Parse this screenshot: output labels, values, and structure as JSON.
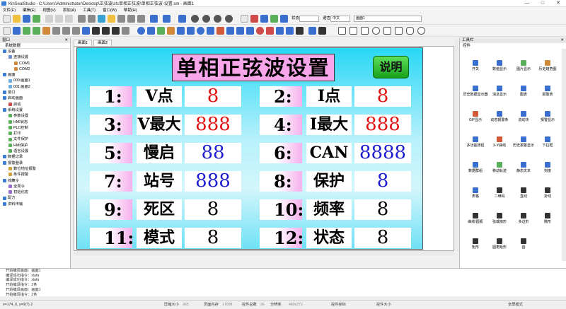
{
  "window": {
    "title": "KinSealStudio - C:\\Users\\Administrator\\Desktop\\正弦波\\stc单相正弦波\\单相正弦波-设置.sm - 画面1",
    "min": "—",
    "max": "□",
    "close": "✕"
  },
  "menu": [
    "文件(F)",
    "编辑(E)",
    "视图(V)",
    "添加(A)",
    "工具(T)",
    "窗口(W)",
    "帮助(H)"
  ],
  "toolbar": {
    "status_label": "状态",
    "status_value": "",
    "lang_label": "语言",
    "lang_value": "中文",
    "screen_value": "画面1"
  },
  "left_panel": {
    "title": "窗口",
    "close": "✕",
    "tab": "系统数据",
    "tree": [
      {
        "label": "设备",
        "level": 0,
        "color": "#3a7bd5"
      },
      {
        "label": "连接设置",
        "level": 1,
        "color": "#6a8fd0"
      },
      {
        "label": "COM1",
        "level": 2,
        "color": "#d08a3a"
      },
      {
        "label": "COM2",
        "level": 2,
        "color": "#d08a3a"
      },
      {
        "label": "画面",
        "level": 0,
        "color": "#3a7bd5"
      },
      {
        "label": "000:画面1",
        "level": 1,
        "color": "#6ab0e0"
      },
      {
        "label": "001:画面2",
        "level": 1,
        "color": "#6ab0e0"
      },
      {
        "label": "窗口",
        "level": 0,
        "color": "#3a7bd5"
      },
      {
        "label": "启动画面",
        "level": 0,
        "color": "#3a7bd5"
      },
      {
        "label": "启动",
        "level": 1,
        "color": "#d04a4a"
      },
      {
        "label": "系统设置",
        "level": 0,
        "color": "#3a7bd5"
      },
      {
        "label": "参数设置",
        "level": 1,
        "color": "#5ab05a"
      },
      {
        "label": "HMI状态",
        "level": 1,
        "color": "#5ab05a"
      },
      {
        "label": "PLC控制",
        "level": 1,
        "color": "#5ab05a"
      },
      {
        "label": "打印",
        "level": 1,
        "color": "#5ab05a"
      },
      {
        "label": "文件保护",
        "level": 1,
        "color": "#5ab05a"
      },
      {
        "label": "HMI保护",
        "level": 1,
        "color": "#5ab05a"
      },
      {
        "label": "语言设置",
        "level": 1,
        "color": "#5ab05a"
      },
      {
        "label": "数据记录",
        "level": 0,
        "color": "#3a7bd5"
      },
      {
        "label": "报警登录",
        "level": 0,
        "color": "#3a7bd5"
      },
      {
        "label": "数位地址报警",
        "level": 1,
        "color": "#d0a03a"
      },
      {
        "label": "条件报警",
        "level": 1,
        "color": "#d0a03a"
      },
      {
        "label": "收藏令",
        "level": 0,
        "color": "#3a7bd5"
      },
      {
        "label": "全局令",
        "level": 1,
        "color": "#9a6ad0"
      },
      {
        "label": "初始化宏",
        "level": 1,
        "color": "#9a6ad0"
      },
      {
        "label": "配方",
        "level": 0,
        "color": "#3a7bd5"
      },
      {
        "label": "资料传输",
        "level": 0,
        "color": "#3a7bd5"
      }
    ]
  },
  "tabs": [
    "画面1",
    "画面2"
  ],
  "screen": {
    "title": "单相正弦波设置",
    "help_button": "说明",
    "rows": [
      [
        {
          "num": "1:",
          "label": "V点",
          "value": "8",
          "color": "red"
        },
        {
          "num": "2:",
          "label": "I点",
          "value": "8",
          "color": "red"
        }
      ],
      [
        {
          "num": "3:",
          "label": "V最大",
          "value": "888",
          "color": "red"
        },
        {
          "num": "4:",
          "label": "I最大",
          "value": "888",
          "color": "red"
        }
      ],
      [
        {
          "num": "5:",
          "label": "慢启",
          "value": "88",
          "color": "blue"
        },
        {
          "num": "6:",
          "label": "CAN",
          "value": "8888",
          "color": "blue"
        }
      ],
      [
        {
          "num": "7:",
          "label": "站号",
          "value": "888",
          "color": "blue"
        },
        {
          "num": "8:",
          "label": "保护",
          "value": "8",
          "color": "blue"
        }
      ],
      [
        {
          "num": "9:",
          "label": "死区",
          "value": "8",
          "color": "black"
        },
        {
          "num": "10:",
          "label": "频率",
          "value": "8",
          "color": "black"
        }
      ],
      [
        {
          "num": "11:",
          "label": "模式",
          "value": "8",
          "color": "black"
        },
        {
          "num": "12:",
          "label": "状态",
          "value": "8",
          "color": "black"
        }
      ]
    ]
  },
  "right_panel": {
    "title": "工具栏",
    "close": "✕",
    "tab": "控件",
    "items": [
      {
        "label": "开关",
        "color": "#3a6fd0"
      },
      {
        "label": "数值显示",
        "color": "#3a6fd0"
      },
      {
        "label": "图片显示",
        "color": "#5ab05a"
      },
      {
        "label": "历史趋势图",
        "color": "#d08a3a"
      },
      {
        "label": "历史数据显示器",
        "color": "#3a6fd0"
      },
      {
        "label": "消息显示",
        "color": "#3a6fd0"
      },
      {
        "label": "图表",
        "color": "#3a6fd0"
      },
      {
        "label": "报警表",
        "color": "#3a6fd0"
      },
      {
        "label": "GIF显示",
        "color": "#d05a3a"
      },
      {
        "label": "动态报警条",
        "color": "#3a6fd0"
      },
      {
        "label": "流动块",
        "color": "#3a6fd0"
      },
      {
        "label": "报警显示",
        "color": "#3a6fd0"
      },
      {
        "label": "多功能按钮",
        "color": "#3a6fd0"
      },
      {
        "label": "X-Y曲线",
        "color": "#d05a3a"
      },
      {
        "label": "历史报警显示",
        "color": "#3a6fd0"
      },
      {
        "label": "下拉框",
        "color": "#3a6fd0"
      },
      {
        "label": "数据群组",
        "color": "#3a6fd0"
      },
      {
        "label": "移动轨迹",
        "color": "#5ab05a"
      },
      {
        "label": "静态文本",
        "color": "#3a6fd0"
      },
      {
        "label": "刻度",
        "color": "#3a6fd0"
      },
      {
        "label": "表格",
        "color": "#3a6fd0"
      },
      {
        "label": "二维码",
        "color": "#333333"
      },
      {
        "label": "直线",
        "color": "#333333"
      },
      {
        "label": "折线",
        "color": "#333333"
      },
      {
        "label": "曲线/圆弧",
        "color": "#333333"
      },
      {
        "label": "弦或扇形",
        "color": "#333333"
      },
      {
        "label": "多边形",
        "color": "#333333"
      },
      {
        "label": "椭形",
        "color": "#333333"
      },
      {
        "label": "矩形",
        "color": "#333333"
      },
      {
        "label": "圆角矩形",
        "color": "#333333"
      },
      {
        "label": "圆",
        "color": "#333333"
      }
    ]
  },
  "output": {
    "lines": [
      "开始编译画面：画面1",
      "编译成功指令：xlafa",
      "编译成功指令：xlafa",
      "开始编译指令：2条",
      "开始编译画面：画面1",
      "开始编译指令：2条"
    ]
  },
  "statusbar": {
    "coord": "x=174, 0, y=0(?) 2",
    "compress_label": "压缩大小",
    "compress_value": "365",
    "mem_label": "页面内存",
    "mem_value": "17008",
    "ctrl_label": "控件总数",
    "ctrl_value": "36",
    "res_label": "分辨率",
    "res_value": "480x272",
    "coord_label": "控件坐标",
    "coord_value": "",
    "size_label": "控件大小",
    "size_value": "",
    "mode_label": "全屏模式"
  }
}
